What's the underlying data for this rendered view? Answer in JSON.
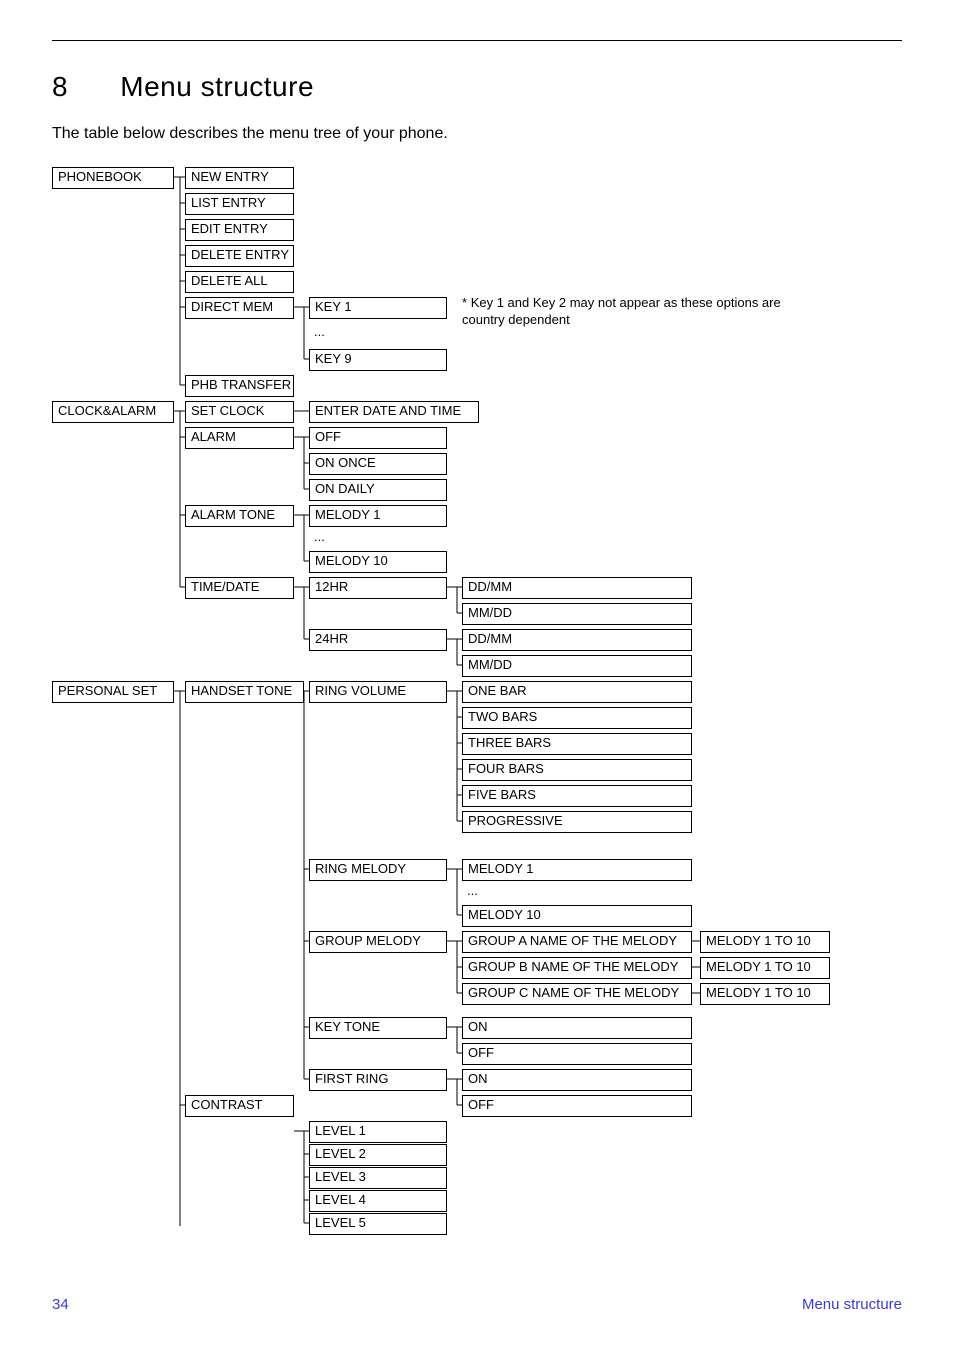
{
  "section_number": "8",
  "section_title": "Menu structure",
  "intro": "The table below describes the menu tree of your phone.",
  "note_star": "*",
  "note_text": "Key 1 and Key 2 may not appear as these options are country dependent",
  "ellipsis": "...",
  "col1": {
    "phonebook": "PHONEBOOK",
    "clockalarm": "CLOCK&ALARM",
    "personalset": "PERSONAL SET"
  },
  "col2": {
    "new_entry": "NEW ENTRY",
    "list_entry": "LIST ENTRY",
    "edit_entry": "EDIT ENTRY",
    "delete_entry": "DELETE ENTRY",
    "delete_all": "DELETE ALL",
    "direct_mem": "DIRECT MEM",
    "phb_transfer": "PHB TRANSFER",
    "set_clock": "SET CLOCK",
    "alarm": "ALARM",
    "alarm_tone": "ALARM TONE",
    "time_date": "TIME/DATE",
    "handset_tone": "HANDSET TONE",
    "contrast": "CONTRAST"
  },
  "col3": {
    "key1": "KEY 1",
    "key9": "KEY 9",
    "enter_dt": "ENTER DATE AND TIME",
    "off": "OFF",
    "on_once": "ON ONCE",
    "on_daily": "ON DAILY",
    "melody1": "MELODY 1",
    "melody10": "MELODY 10",
    "hr12": "12HR",
    "hr24": "24HR",
    "ring_volume": "RING VOLUME",
    "ring_melody": "RING MELODY",
    "group_melody": "GROUP MELODY",
    "key_tone": "KEY TONE",
    "first_ring": "FIRST RING",
    "level1": "LEVEL 1",
    "level2": "LEVEL 2",
    "level3": "LEVEL 3",
    "level4": "LEVEL 4",
    "level5": "LEVEL 5"
  },
  "col4": {
    "ddmm": "DD/MM",
    "mmdd": "MM/DD",
    "one_bar": "ONE BAR",
    "two_bars": "TWO BARS",
    "three_bars": "THREE BARS",
    "four_bars": "FOUR BARS",
    "five_bars": "FIVE BARS",
    "progressive": "PROGRESSIVE",
    "melody1": "MELODY 1",
    "melody10": "MELODY 10",
    "grpA": "GROUP A NAME OF THE MELODY",
    "grpB": "GROUP B NAME OF THE MELODY",
    "grpC": "GROUP C NAME OF THE MELODY",
    "on": "ON",
    "off": "OFF"
  },
  "col5": {
    "range": "MELODY 1 TO 10"
  },
  "footer": {
    "page": "34",
    "title": "Menu structure"
  }
}
